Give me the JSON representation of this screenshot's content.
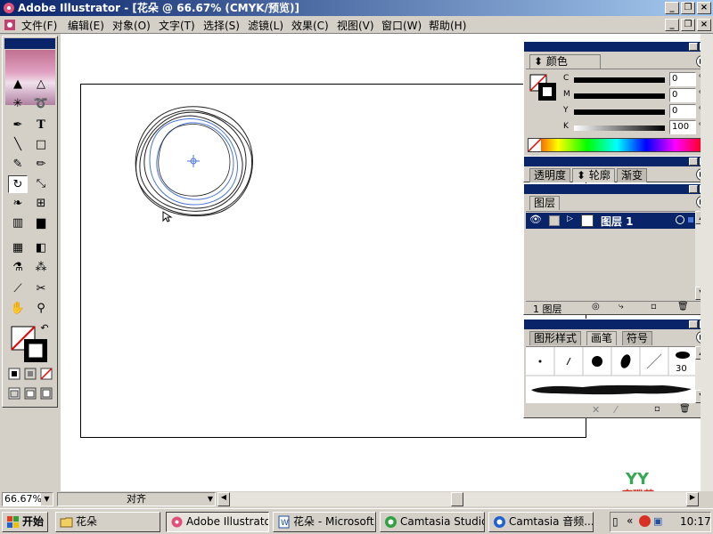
{
  "window": {
    "title": "Adobe Illustrator - [花朵 @ 66.67% (CMYK/预览)]",
    "min_btn": "_",
    "max_btn": "❐",
    "close_btn": "×"
  },
  "menu": [
    "文件(F)",
    "编辑(E)",
    "对象(O)",
    "文字(T)",
    "选择(S)",
    "滤镜(L)",
    "效果(C)",
    "视图(V)",
    "窗口(W)",
    "帮助(H)"
  ],
  "color_panel": {
    "tab": "颜色",
    "channels": [
      {
        "label": "C",
        "value": "0",
        "unit": "%"
      },
      {
        "label": "M",
        "value": "0",
        "unit": "%"
      },
      {
        "label": "Y",
        "value": "0",
        "unit": "%"
      },
      {
        "label": "K",
        "value": "100",
        "unit": "%"
      }
    ]
  },
  "transparency_panel": {
    "tabs": [
      "透明度",
      "轮廓",
      "渐变"
    ]
  },
  "layers_panel": {
    "tab": "图层",
    "layer_name": "图层 1",
    "footer_count": "1 图层"
  },
  "styles_panel": {
    "tabs": [
      "图形样式",
      "画笔",
      "符号"
    ],
    "brush_size": "30"
  },
  "status": {
    "zoom": "66.67%",
    "label": "对齐"
  },
  "watermark": "育碟苑",
  "taskbar": {
    "start": "开始",
    "buttons": [
      "花朵",
      "Adobe Illustrato...",
      "花朵 - Microsoft...",
      "Camtasia Studio...",
      "Camtasia 音频..."
    ],
    "clock": "10:17"
  },
  "colors": {
    "titlebar": "#0a246a",
    "accent": "#4a76d6"
  }
}
